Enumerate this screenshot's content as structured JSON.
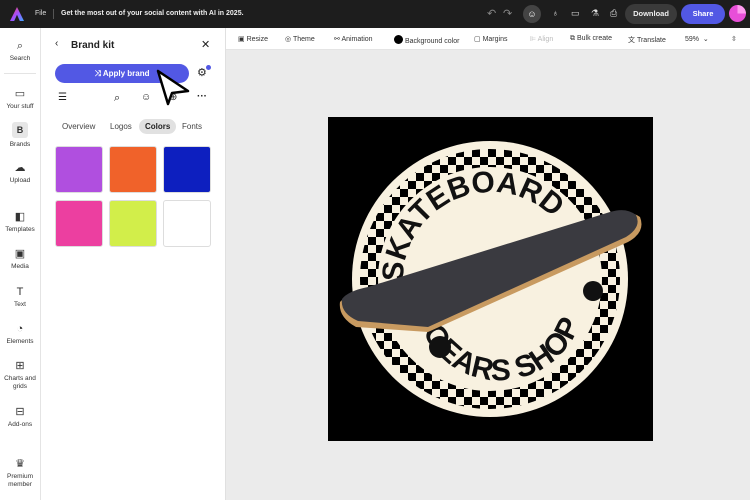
{
  "topbar": {
    "file": "File",
    "promo": "Get the most out of your social content with AI in 2025.",
    "download": "Download",
    "share": "Share"
  },
  "rail": [
    {
      "label": "Search",
      "icon": "search-icon"
    },
    {
      "label": "Your stuff",
      "icon": "folder-icon"
    },
    {
      "label": "Brands",
      "icon": "brand-icon"
    },
    {
      "label": "Upload",
      "icon": "upload-icon"
    },
    {
      "label": "Templates",
      "icon": "templates-icon"
    },
    {
      "label": "Media",
      "icon": "media-icon"
    },
    {
      "label": "Text",
      "icon": "text-icon"
    },
    {
      "label": "Elements",
      "icon": "elements-icon"
    },
    {
      "label": "Charts and grids",
      "icon": "chart-icon"
    },
    {
      "label": "Add-ons",
      "icon": "addons-icon"
    },
    {
      "label": "Premium member",
      "icon": "crown-icon"
    }
  ],
  "panel": {
    "title": "Brand kit",
    "apply": "Apply brand",
    "tabs": [
      "Overview",
      "Logos",
      "Colors",
      "Fonts"
    ],
    "active_tab": "Colors",
    "colors": [
      "#b04fdf",
      "#f0622a",
      "#0d1fbf",
      "#ec3fa0",
      "#d2ee4a",
      "#ffffff"
    ]
  },
  "toolbar": {
    "resize": "Resize",
    "theme": "Theme",
    "animation": "Animation",
    "background": "Background color",
    "margins": "Margins",
    "align": "Align",
    "bulk": "Bulk create",
    "translate": "Translate",
    "zoom": "59%"
  },
  "logo": {
    "top_text": "SKATEBOARD",
    "bottom_text": "GEARS SHOP"
  },
  "colors": {
    "accent": "#5258e4",
    "topbar": "#1d1d1d"
  }
}
